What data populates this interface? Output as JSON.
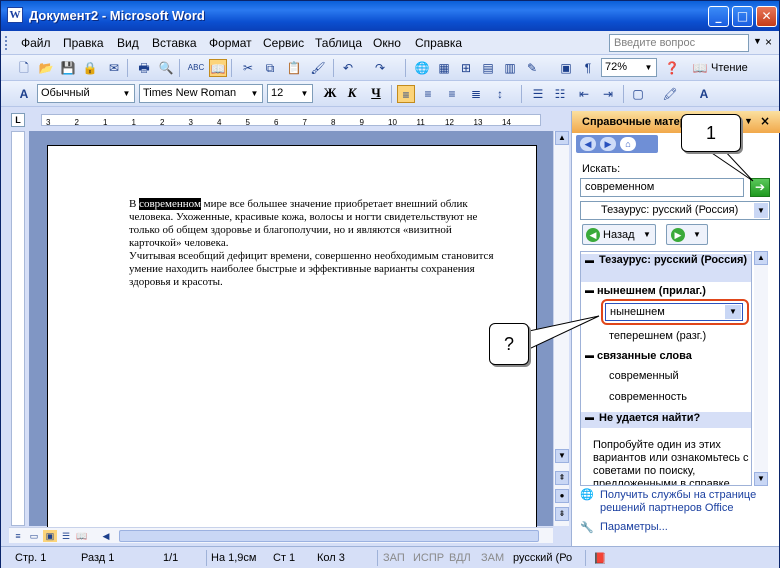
{
  "window": {
    "title": "Документ2 - Microsoft Word",
    "app_icon": "W"
  },
  "titlebar_buttons": {
    "minimize": "_",
    "maximize": "□",
    "close": "✕"
  },
  "menu": {
    "items": [
      "Файл",
      "Правка",
      "Вид",
      "Вставка",
      "Формат",
      "Сервис",
      "Таблица",
      "Окно",
      "Справка"
    ],
    "ask_placeholder": "Введите вопрос",
    "close": "×"
  },
  "toolbar1": {
    "zoom": "72%",
    "read_label": "Чтение"
  },
  "toolbar2": {
    "style": "Обычный",
    "font": "Times New Roman",
    "size": "12",
    "bold": "Ж",
    "italic": "К",
    "underline": "Ч"
  },
  "ruler": {
    "corner": "L",
    "marks": [
      "3",
      "2",
      "1",
      "1",
      "2",
      "3",
      "4",
      "5",
      "6",
      "7",
      "8",
      "9",
      "10",
      "11",
      "12",
      "13",
      "14"
    ]
  },
  "document": {
    "highlighted_word": "современном",
    "p1_before": "В ",
    "p1_after": " мире все большее значение приобретает внешний облик человека. Ухоженные, красивые кожа, волосы и ногти свидетельствуют не только об общем здоровье и благополучии, но и являются «визитной карточкой» человека.",
    "p2": "Учитывая всеобщий дефицит времени, совершенно необходимым становится умение находить наиболее быстрые и эффективные варианты сохранения здоровья и красоты."
  },
  "status": {
    "page": "Стр. 1",
    "section": "Разд 1",
    "pages": "1/1",
    "at": "На 1,9см",
    "line": "Ст 1",
    "col": "Кол 3",
    "rec": "ЗАП",
    "trk": "ИСПР",
    "ext": "ВДЛ",
    "ovr": "ЗАМ",
    "lang": "русский (Ро"
  },
  "pane": {
    "title": "Справочные материалы",
    "search_label": "Искать:",
    "search_value": "современном",
    "source": "Тезаурус: русский (Россия)",
    "back_label": "Назад",
    "results_header": "Тезаурус: русский (Россия)",
    "sense1": "нынешнем (прилаг.)",
    "selected_word": "нынешнем",
    "word2": "теперешнем (разг.)",
    "related_header": "связанные слова",
    "related": [
      "современный",
      "современность"
    ],
    "notfound_header": "Не удается найти?",
    "notfound_text": "Попробуйте один из этих вариантов или ознакомьтесь с советами по поиску, предложенными в справке.",
    "link1": "Получить службы на странице решений партнеров Office",
    "link2": "Параметры..."
  },
  "callouts": {
    "one": "1",
    "question": "?"
  },
  "colors": {
    "title_blue": "#0a5fd8",
    "pane_header": "#f1a84a",
    "highlight_border": "#e0461a",
    "go_green": "#1f9a1f"
  }
}
